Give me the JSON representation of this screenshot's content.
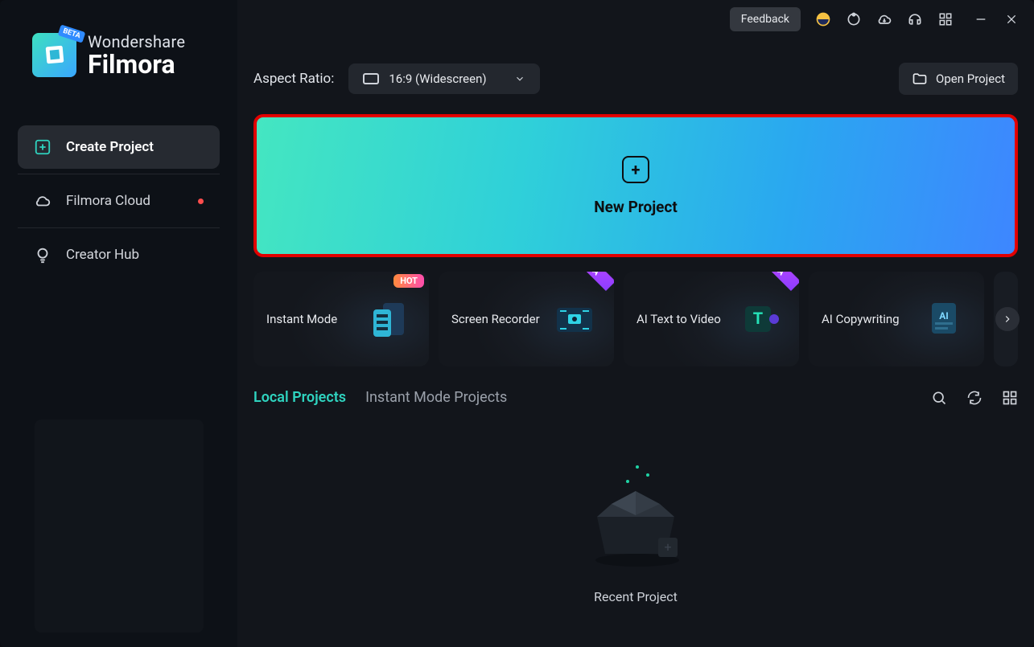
{
  "brand": {
    "top": "Wondershare",
    "bottom": "Filmora",
    "badge": "BETA"
  },
  "sidebar": {
    "items": [
      {
        "label": "Create Project"
      },
      {
        "label": "Filmora Cloud"
      },
      {
        "label": "Creator Hub"
      }
    ]
  },
  "titlebar": {
    "feedback": "Feedback"
  },
  "toolbar": {
    "aspect_label": "Aspect Ratio:",
    "aspect_value": "16:9 (Widescreen)",
    "open_project": "Open Project"
  },
  "new_project": {
    "label": "New Project"
  },
  "cards": [
    {
      "label": "Instant Mode",
      "badge": "HOT"
    },
    {
      "label": "Screen Recorder",
      "badge": "BETA"
    },
    {
      "label": "AI Text to Video",
      "badge": "BETA"
    },
    {
      "label": "AI Copywriting",
      "badge": ""
    }
  ],
  "tabs": {
    "local": "Local Projects",
    "instant": "Instant Mode Projects"
  },
  "empty": {
    "label": "Recent Project"
  }
}
